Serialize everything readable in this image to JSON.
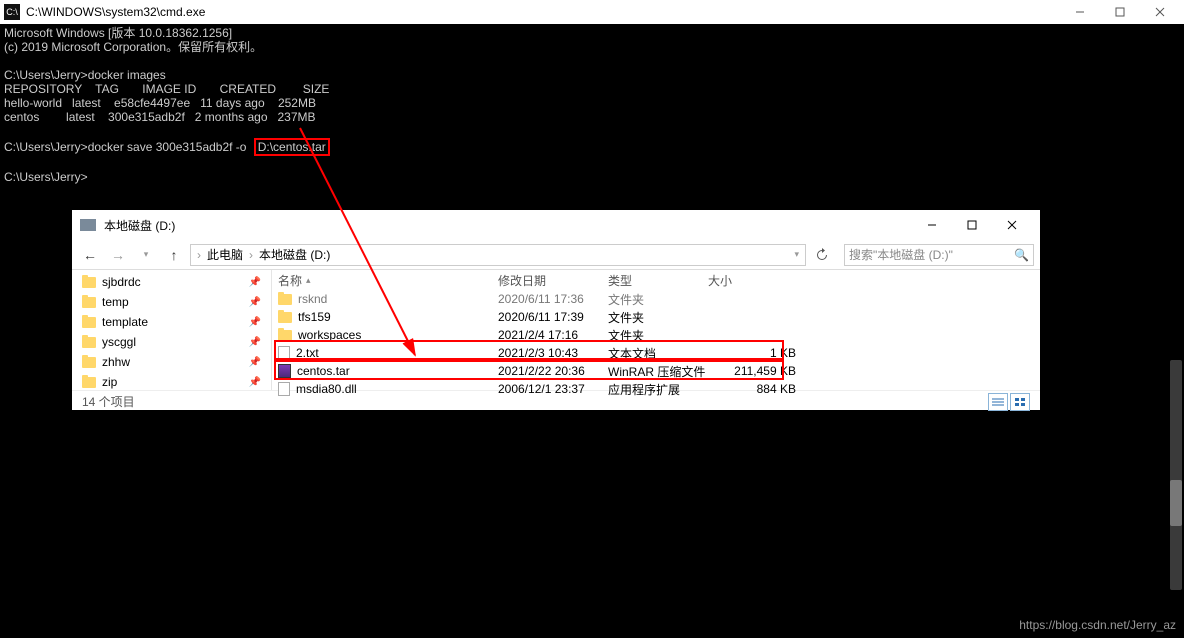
{
  "cmd": {
    "title": "C:\\WINDOWS\\system32\\cmd.exe",
    "lines": {
      "ver": "Microsoft Windows [版本 10.0.18362.1256]",
      "copyright": "(c) 2019 Microsoft Corporation。保留所有权利。",
      "prompt1": "C:\\Users\\Jerry>",
      "cmd1": "docker images",
      "hdr": "REPOSITORY    TAG       IMAGE ID       CREATED        SIZE",
      "row1": "hello-world   latest    e58cfe4497ee   11 days ago    252MB",
      "row2": "centos        latest    300e315adb2f   2 months ago   237MB",
      "prompt2": "C:\\Users\\Jerry>",
      "cmd2a": "docker save 300e315adb2f -o",
      "cmd2b": "D:\\centos.tar",
      "prompt3": "C:\\Users\\Jerry>"
    }
  },
  "explorer": {
    "title": "本地磁盘 (D:)",
    "breadcrumb": {
      "item1": "此电脑",
      "item2": "本地磁盘 (D:)"
    },
    "search_placeholder": "搜索\"本地磁盘 (D:)\"",
    "sidebar": [
      {
        "label": "sjbdrdc",
        "pinned": true
      },
      {
        "label": "temp",
        "pinned": true
      },
      {
        "label": "template",
        "pinned": true
      },
      {
        "label": "yscggl",
        "pinned": true
      },
      {
        "label": "zhhw",
        "pinned": true
      },
      {
        "label": "zip",
        "pinned": true
      }
    ],
    "columns": {
      "name": "名称",
      "date": "修改日期",
      "type": "类型",
      "size": "大小"
    },
    "files": [
      {
        "name": "rsknd",
        "date": "2020/6/11 17:36",
        "type": "文件夹",
        "size": "",
        "icon": "folder",
        "faded": true
      },
      {
        "name": "tfs159",
        "date": "2020/6/11 17:39",
        "type": "文件夹",
        "size": "",
        "icon": "folder"
      },
      {
        "name": "workspaces",
        "date": "2021/2/4 17:16",
        "type": "文件夹",
        "size": "",
        "icon": "folder"
      },
      {
        "name": "2.txt",
        "date": "2021/2/3 10:43",
        "type": "文本文档",
        "size": "1 KB",
        "icon": "doc"
      },
      {
        "name": "centos.tar",
        "date": "2021/2/22 20:36",
        "type": "WinRAR 压缩文件",
        "size": "211,459 KB",
        "icon": "rar",
        "highlighted": true
      },
      {
        "name": "msdia80.dll",
        "date": "2006/12/1 23:37",
        "type": "应用程序扩展",
        "size": "884 KB",
        "icon": "doc"
      }
    ],
    "status": "14 个项目"
  },
  "watermark": "https://blog.csdn.net/Jerry_az"
}
